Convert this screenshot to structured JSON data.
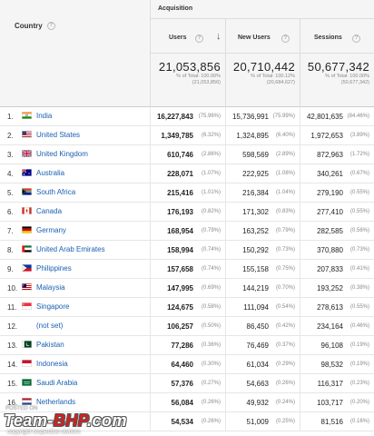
{
  "header": {
    "dimension_label": "Country",
    "group_label": "Acquisition",
    "columns": {
      "users": "Users",
      "new_users": "New Users",
      "sessions": "Sessions"
    },
    "help_glyph": "?",
    "sort_glyph": "↓"
  },
  "totals": {
    "users": {
      "value": "21,053,856",
      "pct": "% of Total: 100.00%",
      "total": "(21,053,856)"
    },
    "new_users": {
      "value": "20,710,442",
      "pct": "% of Total: 100.12%",
      "total": "(20,684,627)"
    },
    "sessions": {
      "value": "50,677,342",
      "pct": "% of Total: 100.00%",
      "total": "(50,677,342)"
    }
  },
  "rows": [
    {
      "idx": "1.",
      "country": "India",
      "flag": "in",
      "users": "16,227,843",
      "users_pct": "(75.96%)",
      "new_users": "15,736,991",
      "new_users_pct": "(75.99%)",
      "sessions": "42,801,635",
      "sessions_pct": "(84.46%)"
    },
    {
      "idx": "2.",
      "country": "United States",
      "flag": "us",
      "users": "1,349,785",
      "users_pct": "(6.32%)",
      "new_users": "1,324,895",
      "new_users_pct": "(6.40%)",
      "sessions": "1,972,653",
      "sessions_pct": "(3.89%)"
    },
    {
      "idx": "3.",
      "country": "United Kingdom",
      "flag": "gb",
      "users": "610,746",
      "users_pct": "(2.86%)",
      "new_users": "598,569",
      "new_users_pct": "(2.89%)",
      "sessions": "872,963",
      "sessions_pct": "(1.72%)"
    },
    {
      "idx": "4.",
      "country": "Australia",
      "flag": "au",
      "users": "228,071",
      "users_pct": "(1.07%)",
      "new_users": "222,925",
      "new_users_pct": "(1.08%)",
      "sessions": "340,261",
      "sessions_pct": "(0.67%)"
    },
    {
      "idx": "5.",
      "country": "South Africa",
      "flag": "za",
      "users": "215,416",
      "users_pct": "(1.01%)",
      "new_users": "216,384",
      "new_users_pct": "(1.04%)",
      "sessions": "279,190",
      "sessions_pct": "(0.55%)"
    },
    {
      "idx": "6.",
      "country": "Canada",
      "flag": "ca",
      "users": "176,193",
      "users_pct": "(0.82%)",
      "new_users": "171,302",
      "new_users_pct": "(0.83%)",
      "sessions": "277,410",
      "sessions_pct": "(0.55%)"
    },
    {
      "idx": "7.",
      "country": "Germany",
      "flag": "de",
      "users": "168,954",
      "users_pct": "(0.79%)",
      "new_users": "163,252",
      "new_users_pct": "(0.79%)",
      "sessions": "282,585",
      "sessions_pct": "(0.56%)"
    },
    {
      "idx": "8.",
      "country": "United Arab Emirates",
      "flag": "ae",
      "users": "158,994",
      "users_pct": "(0.74%)",
      "new_users": "150,292",
      "new_users_pct": "(0.73%)",
      "sessions": "370,880",
      "sessions_pct": "(0.73%)"
    },
    {
      "idx": "9.",
      "country": "Philippines",
      "flag": "ph",
      "users": "157,658",
      "users_pct": "(0.74%)",
      "new_users": "155,158",
      "new_users_pct": "(0.75%)",
      "sessions": "207,833",
      "sessions_pct": "(0.41%)"
    },
    {
      "idx": "10.",
      "country": "Malaysia",
      "flag": "my",
      "users": "147,995",
      "users_pct": "(0.69%)",
      "new_users": "144,219",
      "new_users_pct": "(0.70%)",
      "sessions": "193,252",
      "sessions_pct": "(0.38%)"
    },
    {
      "idx": "11.",
      "country": "Singapore",
      "flag": "sg",
      "users": "124,675",
      "users_pct": "(0.58%)",
      "new_users": "111,094",
      "new_users_pct": "(0.54%)",
      "sessions": "278,613",
      "sessions_pct": "(0.55%)"
    },
    {
      "idx": "12.",
      "country": "(not set)",
      "flag": "",
      "users": "106,257",
      "users_pct": "(0.50%)",
      "new_users": "86,450",
      "new_users_pct": "(0.42%)",
      "sessions": "234,164",
      "sessions_pct": "(0.46%)"
    },
    {
      "idx": "13.",
      "country": "Pakistan",
      "flag": "pk",
      "users": "77,286",
      "users_pct": "(0.36%)",
      "new_users": "76,469",
      "new_users_pct": "(0.37%)",
      "sessions": "96,108",
      "sessions_pct": "(0.19%)"
    },
    {
      "idx": "14.",
      "country": "Indonesia",
      "flag": "id",
      "users": "64,460",
      "users_pct": "(0.30%)",
      "new_users": "61,034",
      "new_users_pct": "(0.29%)",
      "sessions": "98,532",
      "sessions_pct": "(0.19%)"
    },
    {
      "idx": "15.",
      "country": "Saudi Arabia",
      "flag": "sa",
      "users": "57,376",
      "users_pct": "(0.27%)",
      "new_users": "54,663",
      "new_users_pct": "(0.26%)",
      "sessions": "116,317",
      "sessions_pct": "(0.23%)"
    },
    {
      "idx": "16.",
      "country": "Netherlands",
      "flag": "nl",
      "users": "56,084",
      "users_pct": "(0.26%)",
      "new_users": "49,932",
      "new_users_pct": "(0.24%)",
      "sessions": "103,717",
      "sessions_pct": "(0.20%)"
    },
    {
      "idx": "17.",
      "country": "",
      "flag": "",
      "users": "54,534",
      "users_pct": "(0.26%)",
      "new_users": "51,009",
      "new_users_pct": "(0.25%)",
      "sessions": "81,516",
      "sessions_pct": "(0.16%)"
    }
  ],
  "watermark": {
    "top": "POSTED ON",
    "main_a": "Team-",
    "main_b": "BHP",
    "main_c": ".com",
    "bottom": "copyright respective owners"
  }
}
